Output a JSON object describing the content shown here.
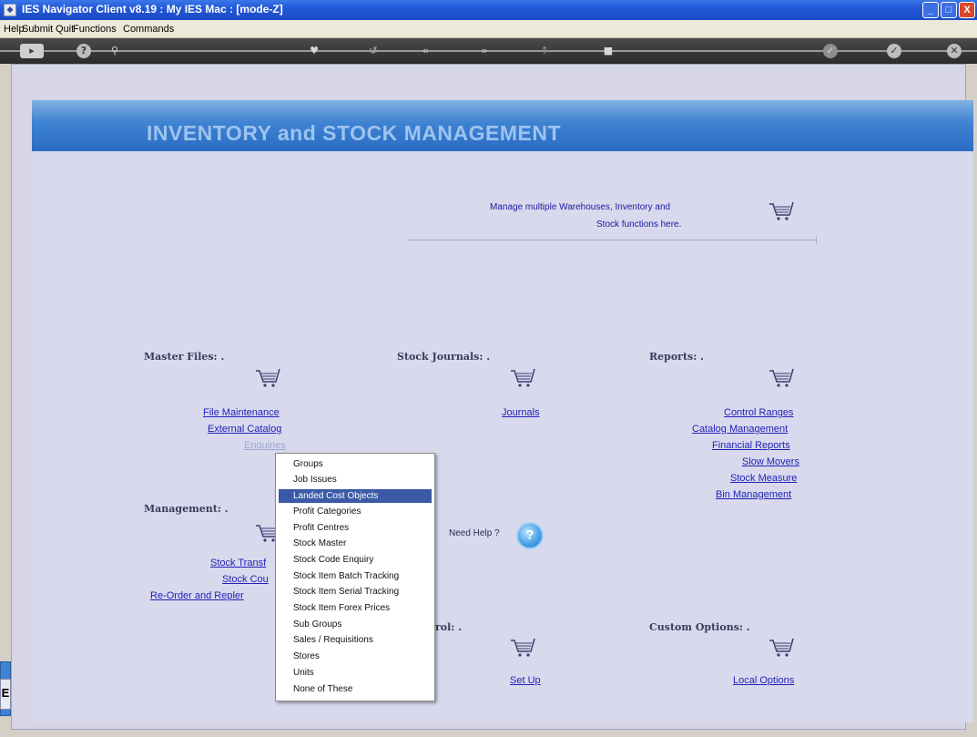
{
  "window": {
    "title": "IES Navigator Client v8.19 : My IES  Mac :      [mode-Z]",
    "minimize": "_",
    "maximize": "□",
    "close": "X"
  },
  "menu": {
    "items": [
      "Help",
      "Submit",
      "Quit",
      "Functions",
      "Commands"
    ]
  },
  "toolbar": {
    "icons": [
      "home-icon",
      "help-icon",
      "search-icon",
      "favourites-icon",
      "refresh-icon",
      "back-icon",
      "forward-icon",
      "bookmark-icon",
      "stop-icon",
      "apply-icon",
      "ok-icon",
      "close-icon"
    ],
    "glyphs": [
      "?",
      "⚲",
      "♥",
      "↺",
      "«",
      "»",
      "↑",
      "■",
      "✓",
      "✓",
      "✕"
    ]
  },
  "banner": {
    "title": "INVENTORY and STOCK MANAGEMENT"
  },
  "info": {
    "line1": "Manage multiple Warehouses, Inventory and",
    "line2": "Stock functions here."
  },
  "sections": {
    "master_files": {
      "heading": "Master Files: .",
      "links": [
        "File Maintenance",
        "External Catalog",
        "Enquiries"
      ]
    },
    "stock_journals": {
      "heading": "Stock Journals: .",
      "links": [
        "Journals"
      ]
    },
    "reports": {
      "heading": "Reports: .",
      "links": [
        "Control Ranges",
        "Catalog Management",
        "Financial Reports",
        "Slow Movers",
        "Stock Measure",
        "Bin Management"
      ]
    },
    "management": {
      "heading": "Management: .",
      "links": [
        "Stock Transf",
        "Stock Cou",
        "Re-Order and Repler"
      ]
    },
    "control": {
      "heading": "rol: .",
      "links": [
        "Set Up"
      ]
    },
    "custom_options": {
      "heading": "Custom Options: .",
      "links": [
        "Local Options"
      ]
    }
  },
  "help": {
    "label": "Need Help ?",
    "glyph": "?"
  },
  "side_stub": {
    "label": "E"
  },
  "dropdown": {
    "selected_index": 2,
    "items": [
      "Groups",
      "Job Issues",
      "Landed Cost Objects",
      "Profit Categories",
      "Profit Centres",
      "Stock Master",
      "Stock Code Enquiry",
      "Stock Item Batch Tracking",
      "Stock Item Serial Tracking",
      "Stock Item Forex Prices",
      "Sub Groups",
      "Sales / Requisitions",
      "Stores",
      "Units",
      "None of These"
    ]
  },
  "colors": {
    "banner": "#2a6cc3",
    "panel": "#d8d9ed",
    "link": "#2222b8",
    "selected_item": "#3b5aa6"
  }
}
